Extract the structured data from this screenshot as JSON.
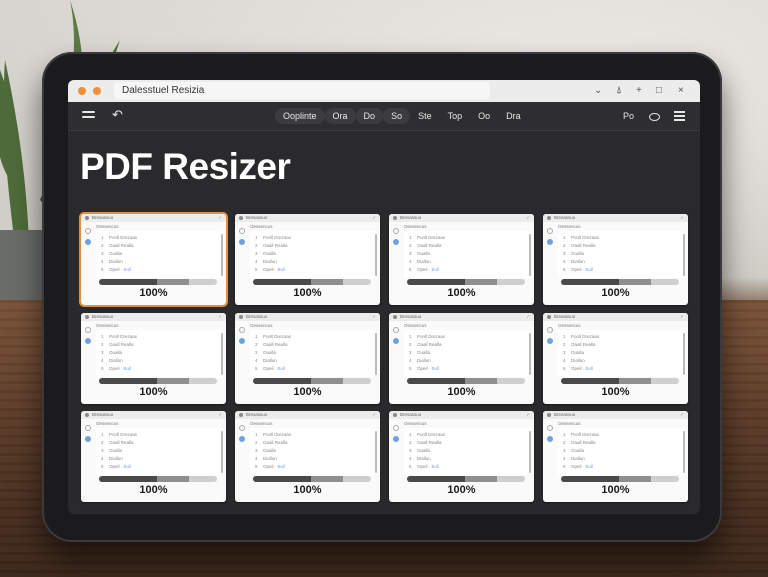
{
  "window": {
    "address": "Dalesstuel Resizia",
    "controls": [
      "⌄",
      "⍋",
      "+",
      "□",
      "×"
    ]
  },
  "toolbar": {
    "tabs": [
      {
        "label": "Ooplinte",
        "selected": true
      },
      {
        "label": "Ora",
        "selected": true
      },
      {
        "label": "Do",
        "selected": true
      },
      {
        "label": "So",
        "selected": true
      },
      {
        "label": "Ste",
        "selected": false
      },
      {
        "label": "Top",
        "selected": false
      },
      {
        "label": "Oo",
        "selected": false
      },
      {
        "label": "Dra",
        "selected": false
      }
    ],
    "right_label": "Po"
  },
  "page": {
    "title": "PDF Resizer"
  },
  "card_template": {
    "header_label": "Bresassuo",
    "subtitle": "Oessencus",
    "items": [
      "Ponll Drezaas",
      "Oaall Realla",
      "Oualla",
      "Diallun",
      "Opeil"
    ],
    "item_suffix": "· Bull"
  },
  "cards": [
    {
      "progress_label": "100%",
      "progress": 1.0,
      "selected": true
    },
    {
      "progress_label": "100%",
      "progress": 1.0,
      "selected": false
    },
    {
      "progress_label": "100%",
      "progress": 1.0,
      "selected": false
    },
    {
      "progress_label": "100%",
      "progress": 1.0,
      "selected": false
    },
    {
      "progress_label": "100%",
      "progress": 1.0,
      "selected": false
    },
    {
      "progress_label": "100%",
      "progress": 1.0,
      "selected": false
    },
    {
      "progress_label": "100%",
      "progress": 1.0,
      "selected": false
    },
    {
      "progress_label": "100%",
      "progress": 1.0,
      "selected": false
    },
    {
      "progress_label": "100%",
      "progress": 1.0,
      "selected": false
    },
    {
      "progress_label": "100%",
      "progress": 1.0,
      "selected": false
    },
    {
      "progress_label": "100%",
      "progress": 1.0,
      "selected": false
    },
    {
      "progress_label": "100%",
      "progress": 1.0,
      "selected": false
    }
  ],
  "colors": {
    "accent": "#e0913f",
    "window_dot": "#f0913a",
    "screen_bg": "#2a2a2d",
    "progress_dark": "#4a4a4a"
  }
}
